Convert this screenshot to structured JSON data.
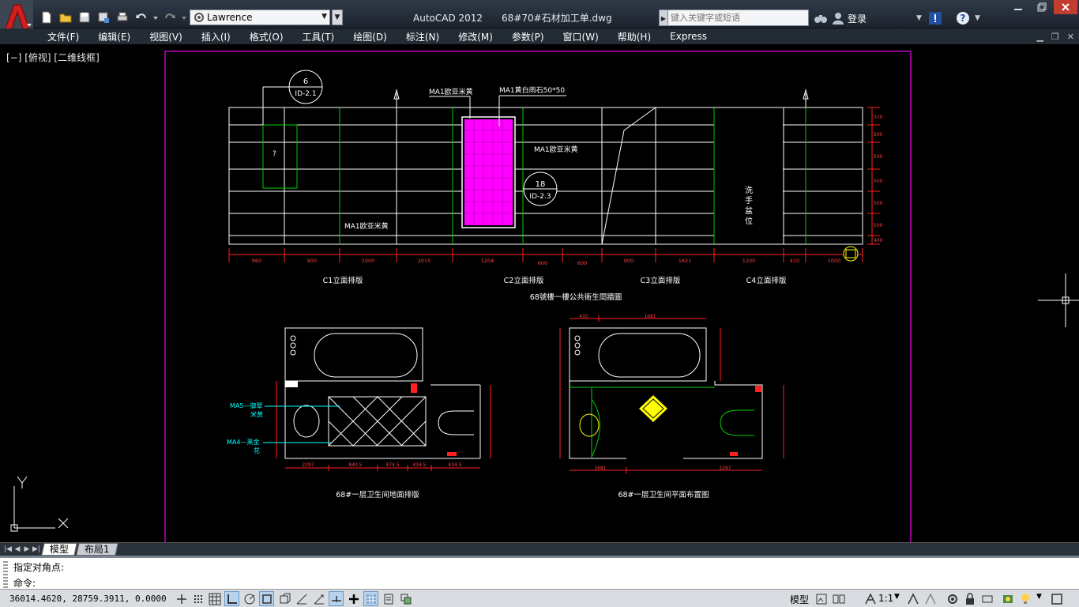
{
  "titlebar": {
    "workspace": "Lawrence",
    "app_name": "AutoCAD 2012",
    "document": "68#70#石材加工单.dwg",
    "search_placeholder": "键入关键字或短语",
    "login": "登录",
    "icons": [
      "new-icon",
      "open-icon",
      "save-icon",
      "saveas-icon",
      "print-icon",
      "undo-icon",
      "redo-icon"
    ]
  },
  "menu": [
    "文件(F)",
    "编辑(E)",
    "视图(V)",
    "插入(I)",
    "格式(O)",
    "工具(T)",
    "绘图(D)",
    "标注(N)",
    "修改(M)",
    "参数(P)",
    "窗口(W)",
    "帮助(H)",
    "Express"
  ],
  "viewport": {
    "label": "[−] [俯视] [二维线框]"
  },
  "drawing": {
    "elevation_title": "68號樓一樓公共衛生間牆圖",
    "elevations": [
      "C1立面排版",
      "C2立面排版",
      "C3立面排版",
      "C4立面排版"
    ],
    "materials": {
      "ma1_top": "MA1欧亚米黄",
      "ma1_small": "MA1黄白雨石50*50",
      "ma1_right": "MA1欧亚米黄",
      "ma1_bottom": "MA1欧亚米黄",
      "ma5": "MA5—御翠",
      "ma5b": "米黄",
      "ma4": "MA4—黑金",
      "ma4b": "花"
    },
    "tag1": {
      "num": "6",
      "ref": "ID-2.1"
    },
    "tag2": {
      "num": "18",
      "ref": "ID-2.3"
    },
    "wash_text": [
      "洗",
      "手",
      "盆",
      "位"
    ],
    "dims_bottom": [
      "960",
      "900",
      "1000",
      "2015",
      "1204",
      "600",
      "600",
      "900",
      "1621",
      "1200",
      "410",
      "1000"
    ],
    "dims_right": [
      "310",
      "500",
      "500",
      "500",
      "500",
      "500",
      "400"
    ],
    "plan1_title": "68#一层卫生间地面排版",
    "plan2_title": "68#一层卫生间平面布置图",
    "plan_dims_top": [
      "410",
      "1681"
    ],
    "plan_dims_bottom1": [
      "2297",
      "840.5",
      "474.5",
      "434.5",
      "434.5"
    ],
    "plan_dims_bottom2": [
      "1681",
      "2297"
    ]
  },
  "layout_tabs": [
    "模型",
    "布局1"
  ],
  "command": {
    "history": "指定对角点:",
    "prompt": "命令:"
  },
  "status": {
    "coords": "36014.4620,  28759.3911,  0.0000",
    "model_label": "模型",
    "annotation_scale": "1:1"
  },
  "colors": {
    "titlebar": "#2f3a48",
    "canvas": "#000000",
    "layout_border": "#c000c0",
    "dimension": "#ff2020",
    "wall": "#ffffff",
    "green": "#00cc00",
    "magenta": "#ff00ff",
    "cyan": "#00ffff",
    "yellow": "#ffff00"
  }
}
